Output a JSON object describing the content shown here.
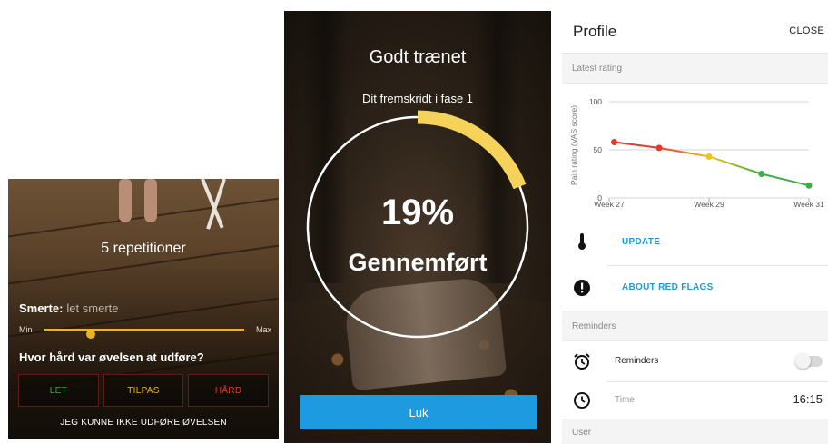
{
  "exercise_screen": {
    "repetitions": "5 repetitioner",
    "pain_label": "Smerte:",
    "pain_value": "let smerte",
    "slider_min": "Min",
    "slider_max": "Max",
    "slider_level": 0.23,
    "question": "Hvor hård var øvelsen at udføre?",
    "buttons": [
      {
        "label": "LET",
        "color": "#3fae4a"
      },
      {
        "label": "TILPAS",
        "color": "#f1b21e"
      },
      {
        "label": "HÅRD",
        "color": "#e53a2b"
      }
    ],
    "cannot_do": "JEG KUNNE IKKE UDFØRE ØVELSEN",
    "accent": "#f1b21e"
  },
  "progress_screen": {
    "title": "Godt trænet",
    "subtitle": "Dit fremskridt i fase 1",
    "percent_text": "19%",
    "progress_fraction": 0.19,
    "completed_label": "Gennemført",
    "close_button": "Luk",
    "ring_color": "#f5d35a",
    "button_color": "#1e9be0"
  },
  "profile_screen": {
    "title": "Profile",
    "close": "CLOSE",
    "latest_rating_section": "Latest rating",
    "reminders_section": "Reminders",
    "user_section": "User",
    "actions": [
      {
        "label": "UPDATE",
        "icon": "thermometer-icon"
      },
      {
        "label": "ABOUT RED FLAGS",
        "icon": "alert-icon"
      }
    ],
    "reminders_label": "Reminders",
    "reminders_on": false,
    "time_label": "Time",
    "time_value": "16:15",
    "link_color": "#1f9ad6"
  },
  "chart_data": {
    "type": "line",
    "ylabel": "Pain rating (VAS score)",
    "ylim": [
      0,
      100
    ],
    "yticks": [
      0,
      50,
      100
    ],
    "xtick_labels": [
      "Week 27",
      "Week 29",
      "Week 31"
    ],
    "xtick_weeks": [
      27,
      29,
      31
    ],
    "xlim": [
      27,
      31
    ],
    "grid": true,
    "points": [
      {
        "week": 27.1,
        "value": 58,
        "color": "#e53a2b"
      },
      {
        "week": 28.0,
        "value": 52,
        "color": "#e53a2b"
      },
      {
        "week": 29.0,
        "value": 43,
        "color": "#f1c21e"
      },
      {
        "week": 30.05,
        "value": 25,
        "color": "#3fae4a"
      },
      {
        "week": 31.0,
        "value": 13,
        "color": "#3fae4a"
      }
    ]
  }
}
